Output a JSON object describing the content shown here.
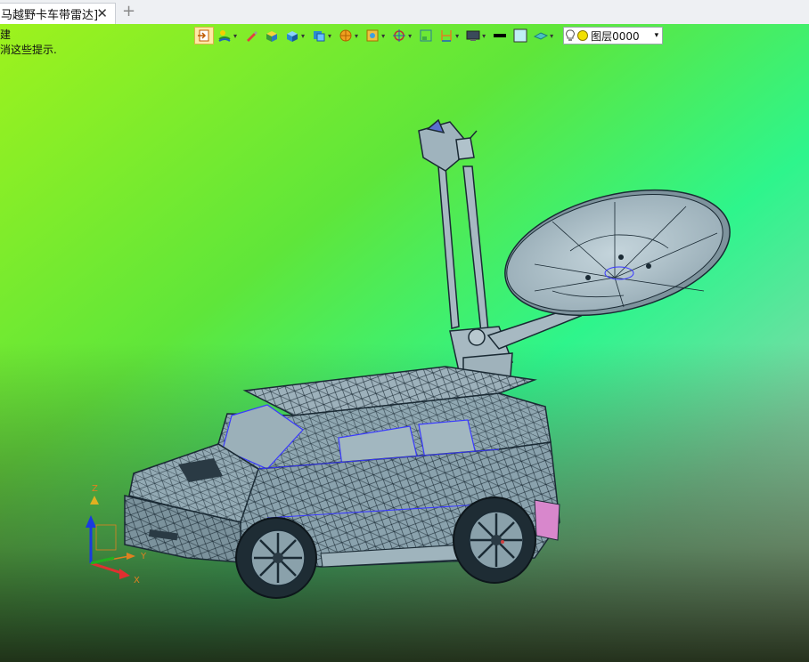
{
  "tab": {
    "title": "马越野卡车带雷达]",
    "close_symbol": "✕",
    "new_symbol": "+"
  },
  "hints": {
    "line1": "建",
    "line2": "消这些提示."
  },
  "toolbar": {
    "layer_name": "图层0000",
    "layer_arrow": "▾",
    "dropdown_arrow": "▾",
    "icons": [
      "exit-view-icon",
      "lights-icon",
      "pen-icon",
      "solid-shade-icon",
      "box-shade-icon",
      "render-mode-icon",
      "appearance-icon",
      "texture-icon",
      "view-orient-icon",
      "fit-view-icon",
      "section-icon",
      "display-mode-icon",
      "color-black-icon",
      "color-lightblue-icon",
      "plane-icon"
    ]
  },
  "triad": {
    "x_label": "X",
    "y_label": "Y",
    "z_label": "Z"
  },
  "colors": {
    "mesh": "#1a2a34",
    "body": "#8fa7b1",
    "dish": "#a9bcc6",
    "edge_blue": "#3a3aff",
    "accent_pink": "#e07fd0"
  }
}
